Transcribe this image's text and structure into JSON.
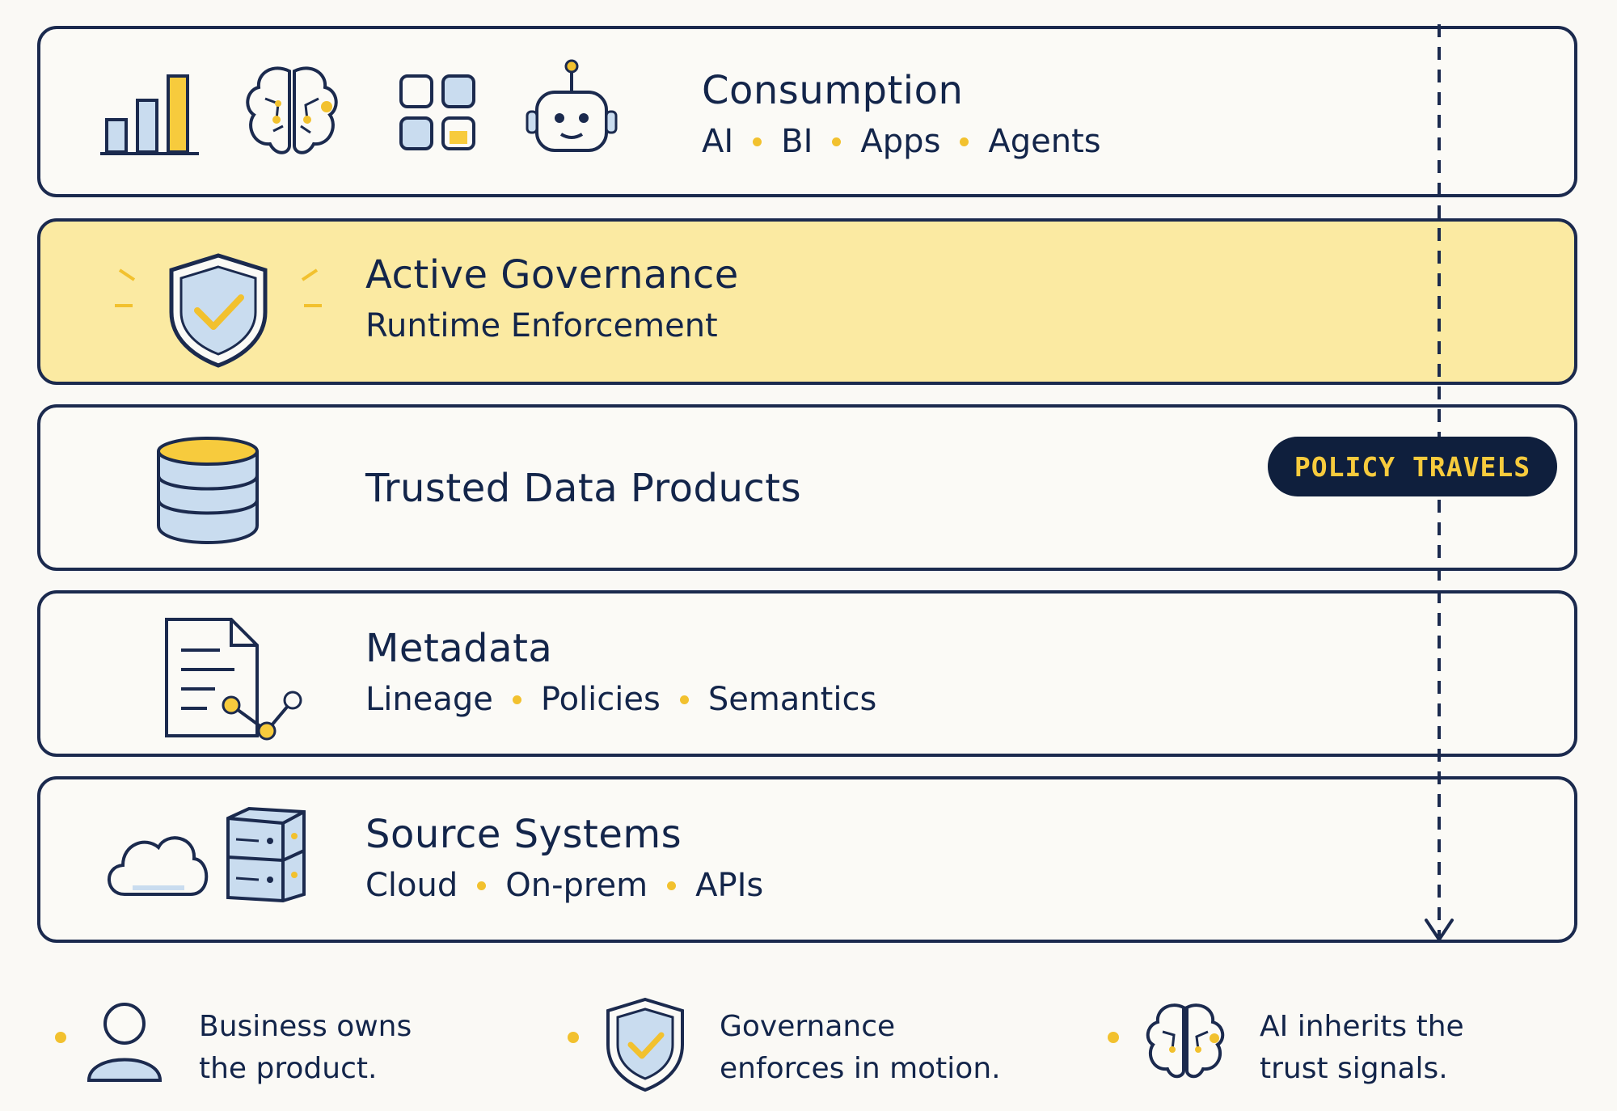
{
  "layers": [
    {
      "title": "Consumption",
      "items": [
        "AI",
        "BI",
        "Apps",
        "Agents"
      ]
    },
    {
      "title": "Active Governance",
      "subtitle": "Runtime Enforcement"
    },
    {
      "title": "Trusted Data Products"
    },
    {
      "title": "Metadata",
      "items": [
        "Lineage",
        "Policies",
        "Semantics"
      ]
    },
    {
      "title": "Source Systems",
      "items": [
        "Cloud",
        "On-prem",
        "APIs"
      ]
    }
  ],
  "badge": "POLICY TRAVELS",
  "footer": [
    {
      "line1": "Business owns",
      "line2": "the product.",
      "icon": "person-icon"
    },
    {
      "line1": "Governance",
      "line2": "enforces in motion.",
      "icon": "shield-check-icon"
    },
    {
      "line1": "AI inherits the",
      "line2": "trust signals.",
      "icon": "brain-icon"
    }
  ],
  "colors": {
    "ink": "#1b2a4e",
    "accent": "#f2c12e",
    "highlight": "#fbeaa2",
    "fill": "#c9dcef"
  }
}
